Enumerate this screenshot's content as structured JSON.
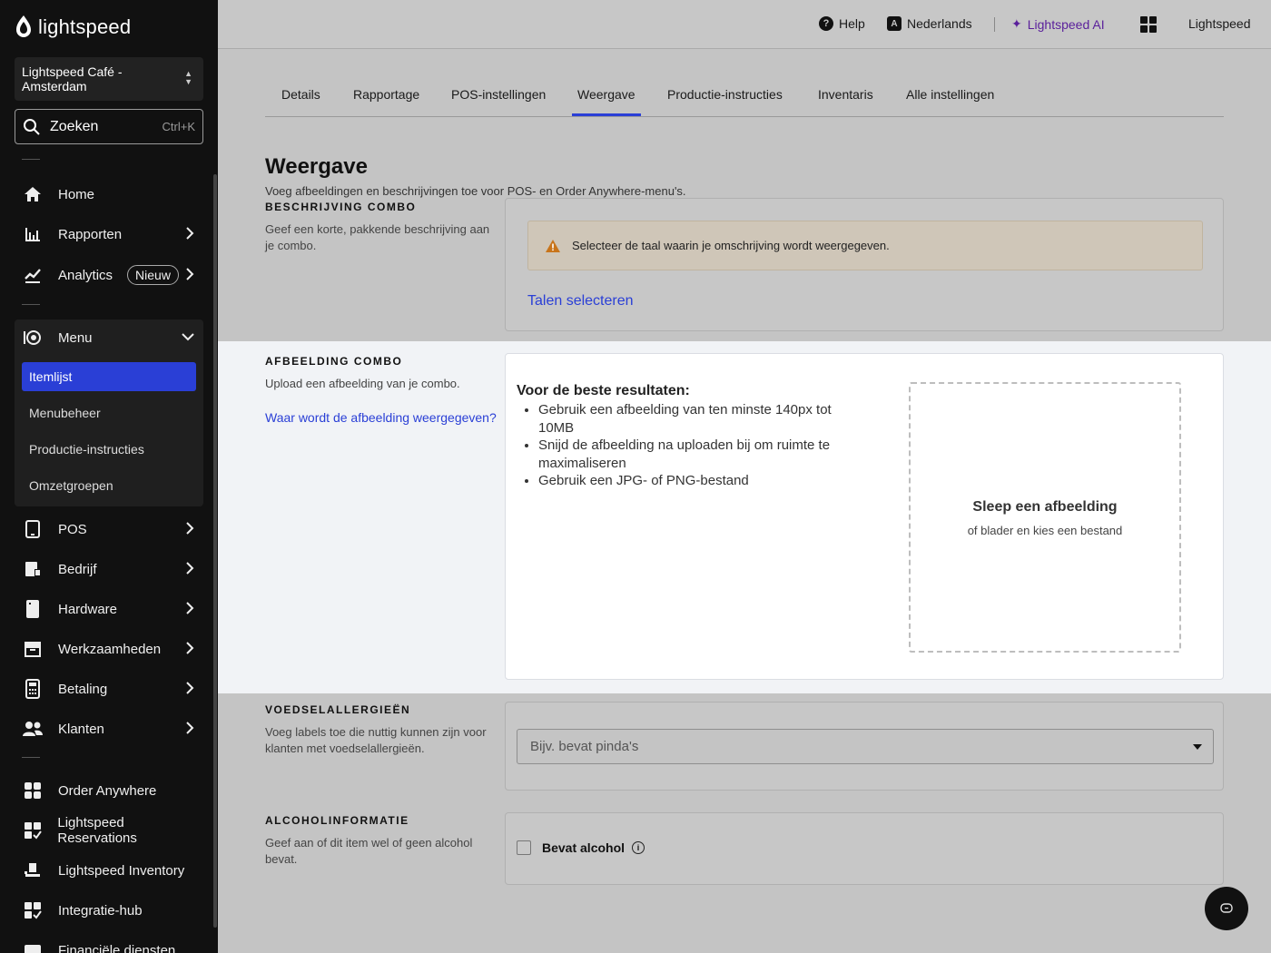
{
  "brand": {
    "name": "lightspeed"
  },
  "location": {
    "line1": "Lightspeed Café -",
    "line2": "Amsterdam"
  },
  "search": {
    "label": "Zoeken",
    "shortcut": "Ctrl+K"
  },
  "sidebar": {
    "items_top": [
      {
        "label": "Home",
        "icon": "home-icon"
      },
      {
        "label": "Rapporten",
        "icon": "bar-chart-icon"
      },
      {
        "label": "Analytics",
        "icon": "trend-icon",
        "badge": "Nieuw"
      }
    ],
    "menu": {
      "label": "Menu",
      "icon": "menu-dish-icon",
      "subitems": [
        "Itemlijst",
        "Menubeheer",
        "Productie-instructies",
        "Omzetgroepen"
      ],
      "active": "Itemlijst"
    },
    "items_mid": [
      {
        "label": "POS",
        "icon": "tablet-icon"
      },
      {
        "label": "Bedrijf",
        "icon": "business-icon"
      },
      {
        "label": "Hardware",
        "icon": "hardware-icon"
      },
      {
        "label": "Werkzaamheden",
        "icon": "archive-icon"
      },
      {
        "label": "Betaling",
        "icon": "payment-terminal-icon"
      },
      {
        "label": "Klanten",
        "icon": "people-icon"
      }
    ],
    "items_bottom": [
      {
        "label": "Order Anywhere",
        "icon": "grid-icon"
      },
      {
        "label": "Lightspeed Reservations",
        "icon": "grid-check-icon"
      },
      {
        "label": "Lightspeed Inventory",
        "icon": "inventory-icon"
      },
      {
        "label": "Integratie-hub",
        "icon": "integration-icon"
      },
      {
        "label": "Financiële diensten",
        "icon": "wallet-icon"
      }
    ]
  },
  "topbar": {
    "help": "Help",
    "language": "Nederlands",
    "ai": "Lightspeed AI",
    "account": "Lightspeed"
  },
  "tabs": [
    "Details",
    "Rapportage",
    "POS-instellingen",
    "Weergave",
    "Productie-instructies",
    "Inventaris",
    "Alle instellingen"
  ],
  "active_tab": "Weergave",
  "page": {
    "title": "Weergave",
    "description": "Voeg afbeeldingen en beschrijvingen toe voor POS- en Order Anywhere-menu's."
  },
  "description_section": {
    "title": "BESCHRIJVING COMBO",
    "desc": "Geef een korte, pakkende beschrijving aan je combo.",
    "warning": "Selecteer de taal waarin je omschrijving wordt weergegeven.",
    "link": "Talen selecteren"
  },
  "image_section": {
    "title": "AFBEELDING COMBO",
    "desc": "Upload een afbeelding van je combo.",
    "link": "Waar wordt de afbeelding weergegeven?",
    "best_title": "Voor de beste resultaten:",
    "tips": [
      "Gebruik een afbeelding van ten minste 140px tot 10MB",
      "Snijd de afbeelding na uploaden bij om ruimte te maximaliseren",
      "Gebruik een JPG- of PNG-bestand"
    ],
    "drop_title": "Sleep een afbeelding",
    "drop_sub": "of blader en kies een bestand"
  },
  "allergy_section": {
    "title": "VOEDSELALLERGIEËN",
    "desc": "Voeg labels toe die nuttig kunnen zijn voor klanten met voedselallergieën.",
    "placeholder": "Bijv. bevat pinda's"
  },
  "alcohol_section": {
    "title": "ALCOHOLINFORMATIE",
    "desc": "Geef aan of dit item wel of geen alcohol bevat.",
    "checkbox_label": "Bevat alcohol"
  },
  "colors": {
    "accent": "#2a3fd6",
    "sidebar": "#111111",
    "ai": "#5a1f9b"
  }
}
